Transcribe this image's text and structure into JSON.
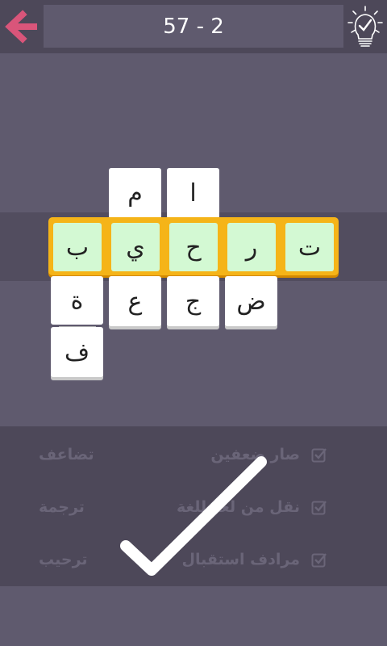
{
  "header": {
    "back_icon": "back-arrow-icon",
    "level_label": "57 - 2",
    "hint_icon": "lightbulb-check-icon"
  },
  "grid": {
    "top_row": [
      "م",
      "ا"
    ],
    "word": [
      "ب",
      "ي",
      "ح",
      "ر",
      "ت"
    ],
    "lower_row": [
      "ة",
      "ع",
      "ج",
      "ض"
    ],
    "bottom_row": [
      "ف"
    ]
  },
  "clues": [
    {
      "text": "صار ضعفين",
      "answer": "تضاعف"
    },
    {
      "text": "نقل من لغة للغة",
      "answer": "ترجمة"
    },
    {
      "text": "مرادف استقبال",
      "answer": "ترحيب"
    }
  ],
  "colors": {
    "accent": "#d9557a",
    "word_bar": "#f5b418",
    "word_tile": "#d3f9d3"
  }
}
